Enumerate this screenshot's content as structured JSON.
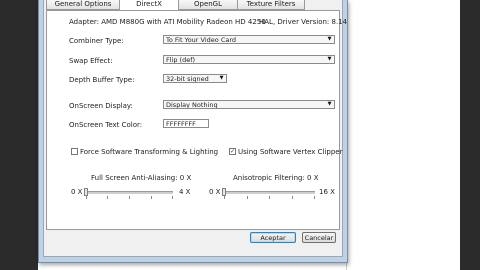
{
  "tabs": [
    "General Options",
    "DirectX",
    "OpenGL",
    "Texture Filters"
  ],
  "active_tab": "DirectX",
  "adapter": {
    "label": "Adapter: AMD M880G with ATI Mobility Radeon HD 4250",
    "driver": "HAL, Driver Version: 8.14"
  },
  "combiner_type": {
    "label": "Combiner Type:",
    "value": "To Fit Your Video Card"
  },
  "swap_effect": {
    "label": "Swap Effect:",
    "value": "Flip (def)"
  },
  "depth_buffer": {
    "label": "Depth Buffer Type:",
    "value": "32-bit signed"
  },
  "onscreen_display": {
    "label": "OnScreen Display:",
    "value": "Display Nothing"
  },
  "onscreen_text_color": {
    "label": "OnScreen Text Color:",
    "value": "FFFFFFFF"
  },
  "force_software": {
    "label": "Force Software Transforming & Lighting",
    "checked": false
  },
  "software_vertex": {
    "label": "Using Software Vertex Clipper",
    "checked": true
  },
  "fsaa": {
    "label": "Full Screen Anti-Aliasing: 0 X",
    "min": "0 X",
    "max": "4 X",
    "value": 0
  },
  "aniso": {
    "label": "Anisotropic Filtering: 0 X",
    "min": "0 X",
    "max": "16 X",
    "value": 0
  },
  "buttons": {
    "ok": "Aceptar",
    "cancel": "Cancelar"
  },
  "check_mark": "✓",
  "dropdown_arrow": "▼"
}
